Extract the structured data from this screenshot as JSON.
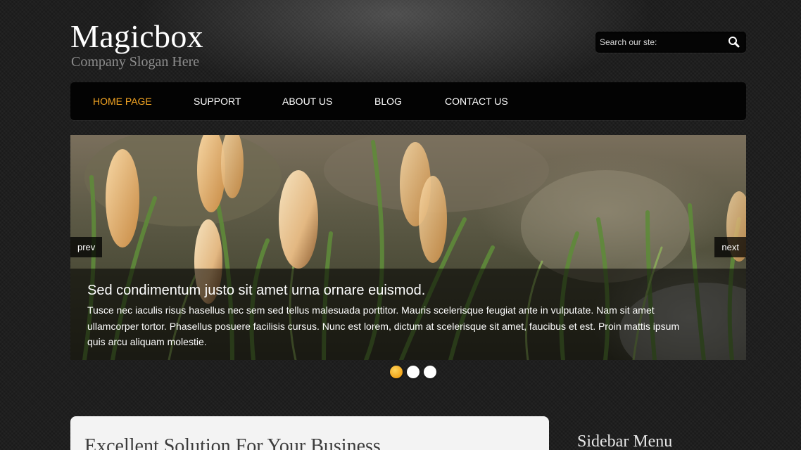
{
  "header": {
    "logo": "Magicbox",
    "slogan": "Company Slogan Here",
    "search_placeholder": "Search our ste:",
    "search_icon": "search-icon"
  },
  "nav": {
    "items": [
      {
        "label": "HOME PAGE",
        "active": true
      },
      {
        "label": "SUPPORT",
        "active": false
      },
      {
        "label": "ABOUT US",
        "active": false
      },
      {
        "label": "BLOG",
        "active": false
      },
      {
        "label": "CONTACT US",
        "active": false
      }
    ],
    "active_color": "#f5a623"
  },
  "slider": {
    "prev_label": "prev",
    "next_label": "next",
    "caption_title": "Sed condimentum justo sit amet urna ornare euismod.",
    "caption_text": "Tusce nec iaculis risus hasellus nec sem sed tellus malesuada porttitor. Mauris scelerisque feugiat ante in vulputate. Nam sit amet ullamcorper tortor. Phasellus posuere facilisis cursus. Nunc est lorem, dictum at scelerisque sit amet, faucibus et est. Proin mattis ipsum quis arcu aliquam molestie.",
    "dots": [
      {
        "active": true
      },
      {
        "active": false
      },
      {
        "active": false
      }
    ]
  },
  "main": {
    "content_title": "Excellent Solution For Your Business"
  },
  "sidebar": {
    "title": "Sidebar Menu"
  }
}
